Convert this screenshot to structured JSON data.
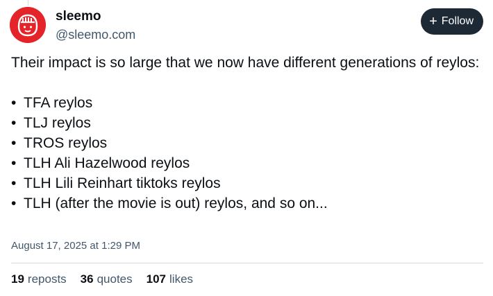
{
  "author": {
    "display_name": "sleemo",
    "handle": "@sleemo.com",
    "avatar_color": "#e5242a",
    "avatar_icon": "cartoon-face-icon"
  },
  "follow_button": {
    "icon": "plus-icon",
    "label": "Follow",
    "background": "#1e2936"
  },
  "post": {
    "text": "Their impact is so large that we now have different generations of reylos:",
    "bullets": [
      "TFA reylos",
      "TLJ reylos",
      "TROS reylos",
      "TLH Ali Hazelwood reylos",
      "TLH Lili Reinhart tiktoks reylos",
      "TLH (after the movie is out) reylos, and so on..."
    ],
    "timestamp": "August 17, 2025 at 1:29 PM"
  },
  "stats": [
    {
      "count": "19",
      "label": "reposts"
    },
    {
      "count": "36",
      "label": "quotes"
    },
    {
      "count": "107",
      "label": "likes"
    }
  ]
}
